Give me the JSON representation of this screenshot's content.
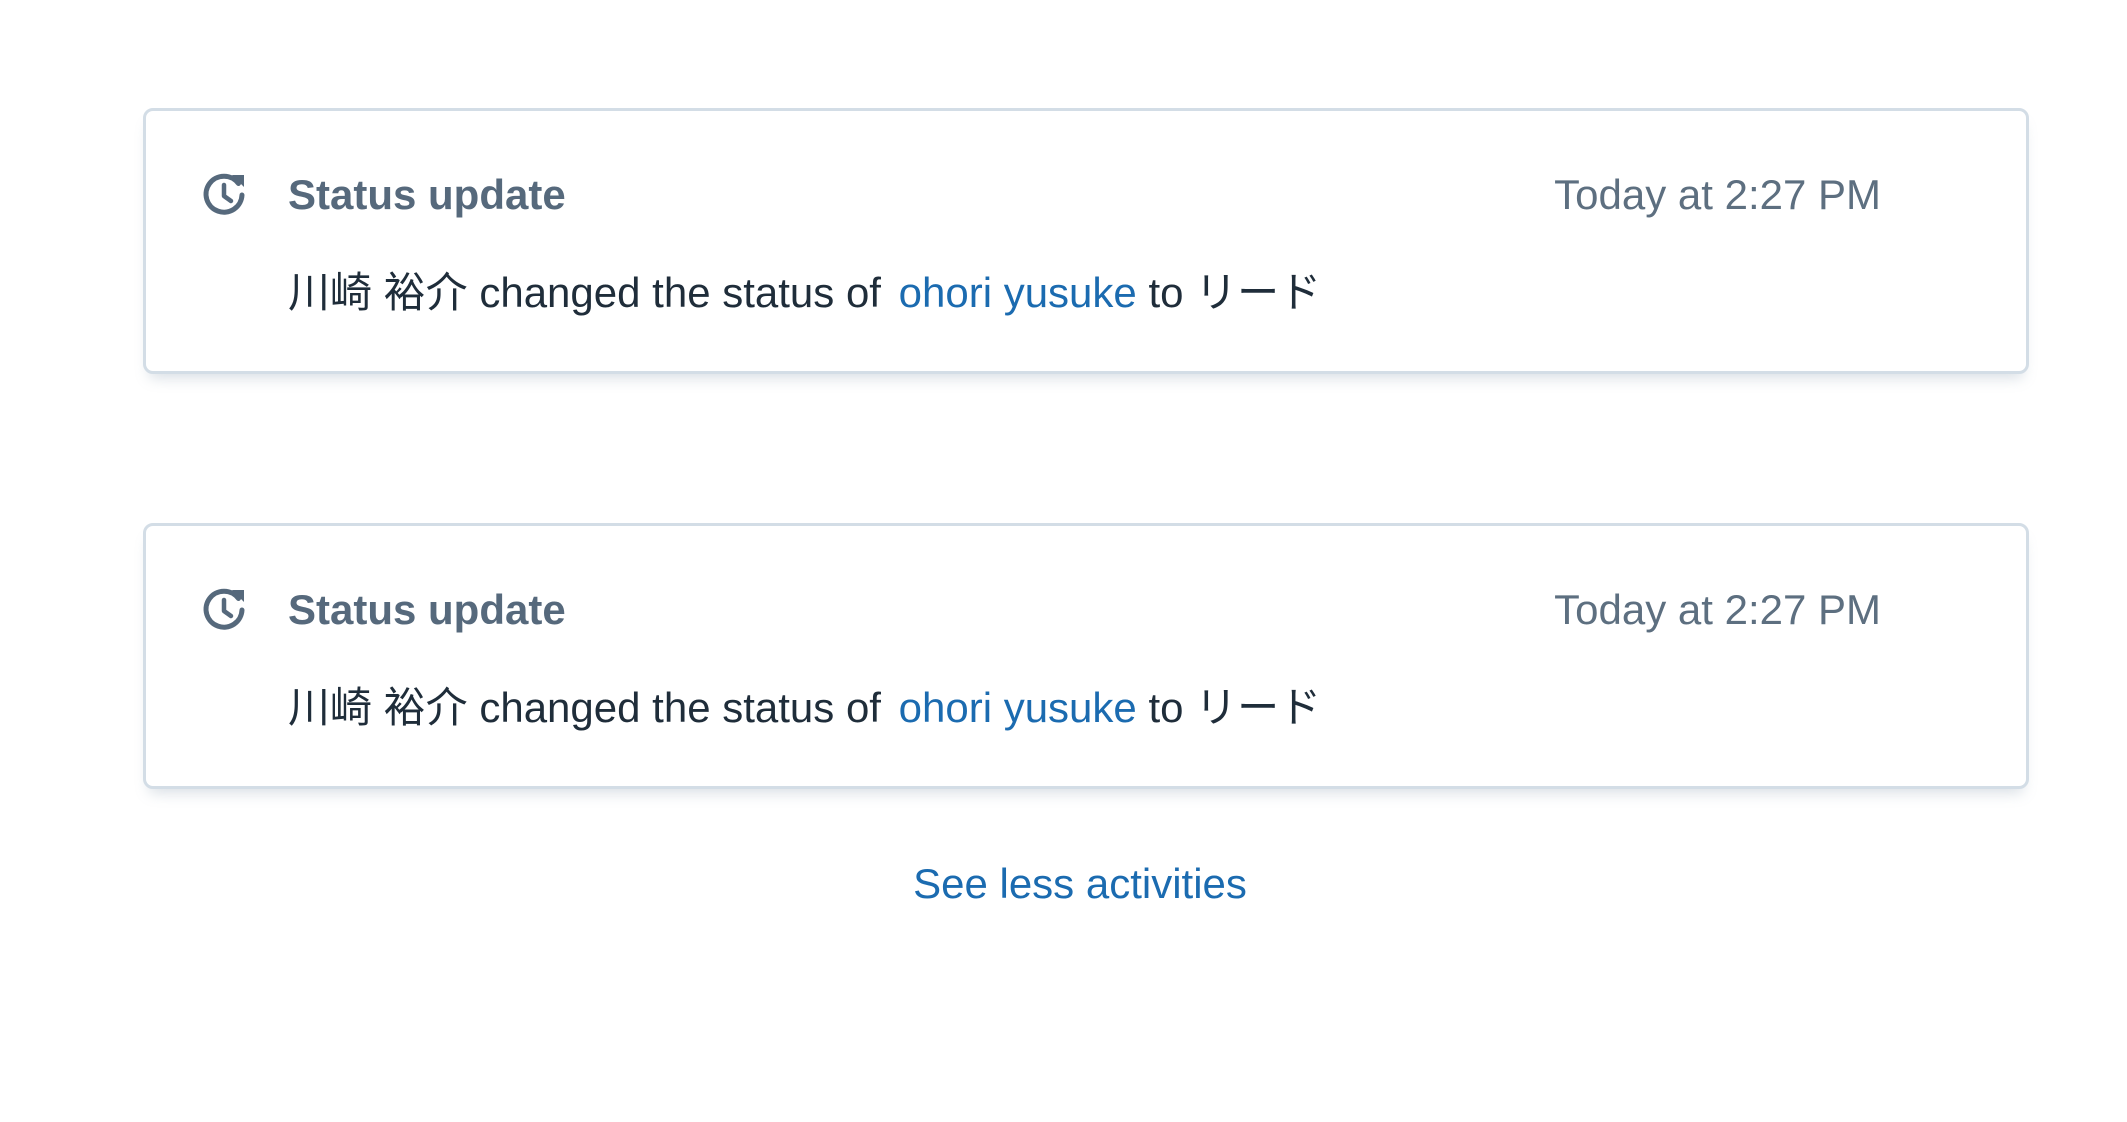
{
  "activities": [
    {
      "icon": "history-clock-icon",
      "title": "Status update",
      "time": "Today at 2:27 PM",
      "actor": "川崎 裕介",
      "action_text": "changed the status of",
      "lead_name": "ohori yusuke",
      "to_word": "to",
      "new_status": "リード"
    },
    {
      "icon": "history-clock-icon",
      "title": "Status update",
      "time": "Today at 2:27 PM",
      "actor": "川崎 裕介",
      "action_text": "changed the status of",
      "lead_name": "ohori yusuke",
      "to_word": "to",
      "new_status": "リード"
    }
  ],
  "see_less_label": "See less activities",
  "colors": {
    "title": "#56697c",
    "time": "#5d6f80",
    "body_text": "#1f2d3a",
    "link": "#1b6bb0",
    "card_border": "#d3dde6"
  }
}
